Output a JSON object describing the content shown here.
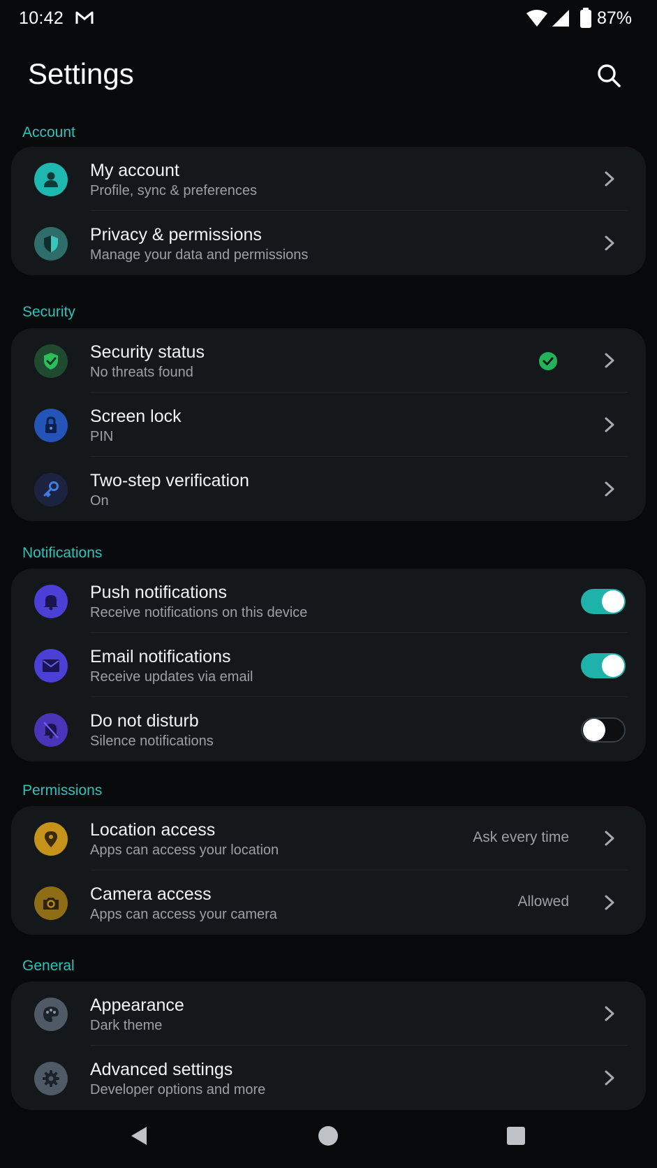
{
  "status_bar": {
    "time": "10:42",
    "battery_percent": "87%",
    "battery_level": 0.87,
    "icons": [
      "gmail-icon",
      "wifi-icon",
      "cell-signal-icon",
      "battery-icon"
    ]
  },
  "header": {
    "title": "Settings",
    "search_icon": "search-icon"
  },
  "colors": {
    "accent": "#2bc4bd",
    "background": "#07090b",
    "card": "#15181b",
    "toggle_on": "#1fb2aa",
    "check_green": "#22b35b"
  },
  "sections": {
    "account": {
      "label": "Account",
      "items": [
        {
          "title": "My account",
          "subtitle": "Profile, sync & preferences",
          "icon": "person-icon"
        },
        {
          "title": "Privacy & permissions",
          "subtitle": "Manage your data and permissions",
          "icon": "shield-icon"
        }
      ]
    },
    "security": {
      "label": "Security",
      "items": [
        {
          "title": "Security status",
          "subtitle": "No threats found",
          "icon": "shield-check-icon",
          "status_icon": "check-circle-icon"
        },
        {
          "title": "Screen lock",
          "subtitle": "PIN",
          "icon": "lock-icon"
        },
        {
          "title": "Two-step verification",
          "subtitle": "On",
          "icon": "key-icon"
        }
      ]
    },
    "notifications": {
      "label": "Notifications",
      "items": [
        {
          "title": "Push notifications",
          "subtitle": "Receive notifications on this device",
          "icon": "bell-icon",
          "enabled": true
        },
        {
          "title": "Email notifications",
          "subtitle": "Receive updates via email",
          "icon": "mail-icon",
          "enabled": true
        },
        {
          "title": "Do not disturb",
          "subtitle": "Silence notifications",
          "icon": "bell-off-icon",
          "enabled": false
        }
      ]
    },
    "permissions": {
      "label": "Permissions",
      "items": [
        {
          "title": "Location access",
          "subtitle": "Apps can access your location",
          "value": "Ask every time",
          "icon": "location-pin-icon"
        },
        {
          "title": "Camera access",
          "subtitle": "Apps can access your camera",
          "value": "Allowed",
          "icon": "camera-icon"
        }
      ]
    },
    "general": {
      "label": "General",
      "items": [
        {
          "title": "Appearance",
          "subtitle": "Dark theme",
          "icon": "palette-icon"
        },
        {
          "title": "Advanced settings",
          "subtitle": "Developer options and more",
          "icon": "gear-icon"
        }
      ]
    }
  },
  "nav_bar": {
    "icons": [
      "back-icon",
      "home-icon",
      "recents-icon"
    ]
  }
}
